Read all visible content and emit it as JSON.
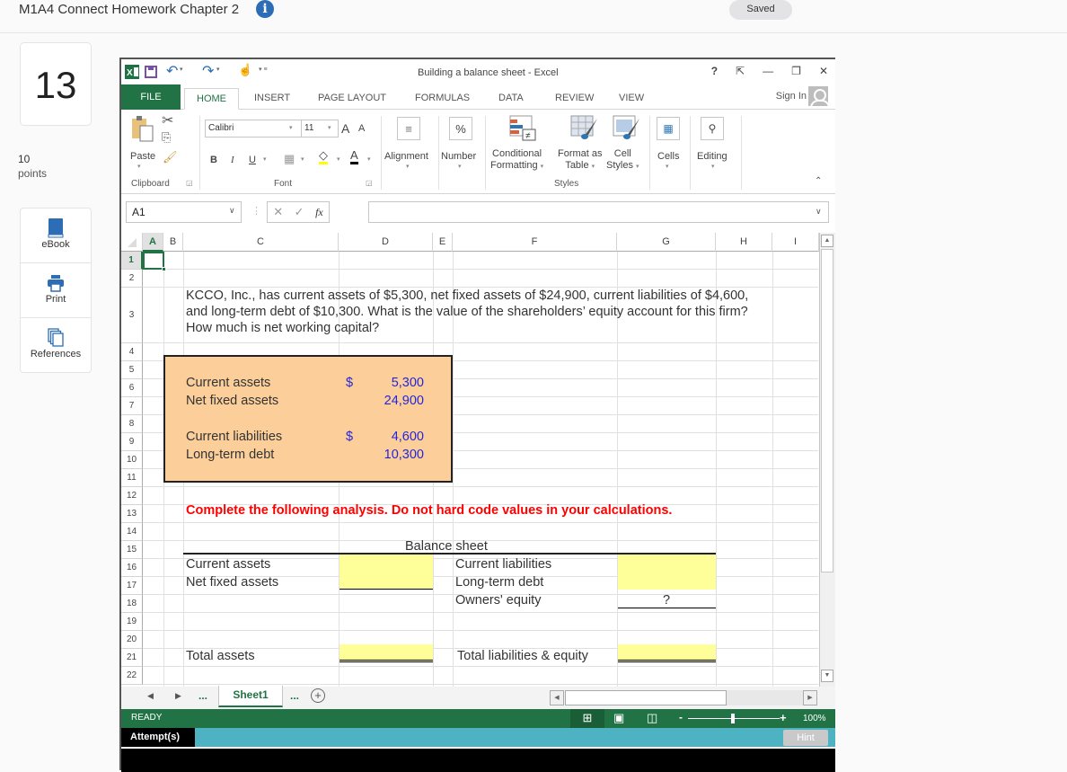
{
  "page": {
    "title": "M1A4 Connect Homework Chapter 2",
    "info_icon": "i",
    "saved_label": "Saved",
    "question_number": "13",
    "points_value": "10",
    "points_label": "points",
    "tools": [
      {
        "icon": "book-icon",
        "label": "eBook"
      },
      {
        "icon": "printer-icon",
        "label": "Print"
      },
      {
        "icon": "copies-icon",
        "label": "References"
      }
    ]
  },
  "excel": {
    "window_title": "Building a balance sheet - Excel",
    "window_controls": [
      "?",
      "⇱",
      "—",
      "❐",
      "✕"
    ],
    "tabs": [
      "FILE",
      "HOME",
      "INSERT",
      "PAGE LAYOUT",
      "FORMULAS",
      "DATA",
      "REVIEW",
      "VIEW"
    ],
    "active_tab": "HOME",
    "sign_in": "Sign In",
    "ribbon": {
      "paste": "Paste",
      "clipboard": "Clipboard",
      "font_name": "Calibri",
      "font_size": "11",
      "bold": "B",
      "italic": "I",
      "underline": "U",
      "font_group": "Font",
      "alignment": "Alignment",
      "number": "Number",
      "number_icon": "%",
      "conditional_formatting_1": "Conditional",
      "conditional_formatting_2": "Formatting",
      "format_as_table_1": "Format as",
      "format_as_table_2": "Table",
      "cell_styles_1": "Cell",
      "cell_styles_2": "Styles",
      "styles_group": "Styles",
      "cells": "Cells",
      "editing": "Editing",
      "grow_font": "A",
      "shrink_font": "A",
      "font_color": "A"
    },
    "name_box": "A1",
    "formula_value": "",
    "fx_label": "fx",
    "columns": [
      "A",
      "B",
      "C",
      "D",
      "E",
      "F",
      "G",
      "H",
      "I"
    ],
    "rows": [
      "1",
      "2",
      "3",
      "4",
      "5",
      "6",
      "7",
      "8",
      "9",
      "10",
      "11",
      "12",
      "13",
      "14",
      "15",
      "16",
      "17",
      "18",
      "19",
      "20",
      "21",
      "22"
    ],
    "problem_text": [
      "KCCO, Inc., has current assets of $5,300, net fixed assets of $24,900, current liabilities of $4,600,",
      "and long-term debt of $10,300. What is the value of the shareholders’ equity account for this firm?",
      "How much is net working capital?"
    ],
    "given": [
      {
        "label": "Current assets",
        "currency": "$",
        "value": "5,300"
      },
      {
        "label": "Net fixed assets",
        "currency": "",
        "value": "24,900"
      },
      {
        "label": "Current liabilities",
        "currency": "$",
        "value": "4,600"
      },
      {
        "label": "Long-term debt",
        "currency": "",
        "value": "10,300"
      }
    ],
    "instruction": "Complete the following analysis. Do not hard code values in your calculations.",
    "balance_sheet": {
      "title": "Balance sheet",
      "assets": [
        "Current assets",
        "Net fixed assets"
      ],
      "liabilities": [
        "Current liabilities",
        "Long-term debt",
        "Owners' equity"
      ],
      "owners_equity_placeholder": "?",
      "total_assets": "Total assets",
      "total_liabilities": "Total liabilities & equity"
    },
    "sheet_tab": "Sheet1",
    "sheet_nav_ellipsis": "...",
    "status": "READY",
    "zoom": "100%",
    "attempts_label": "Attempt(s)",
    "hint_label": "Hint"
  }
}
